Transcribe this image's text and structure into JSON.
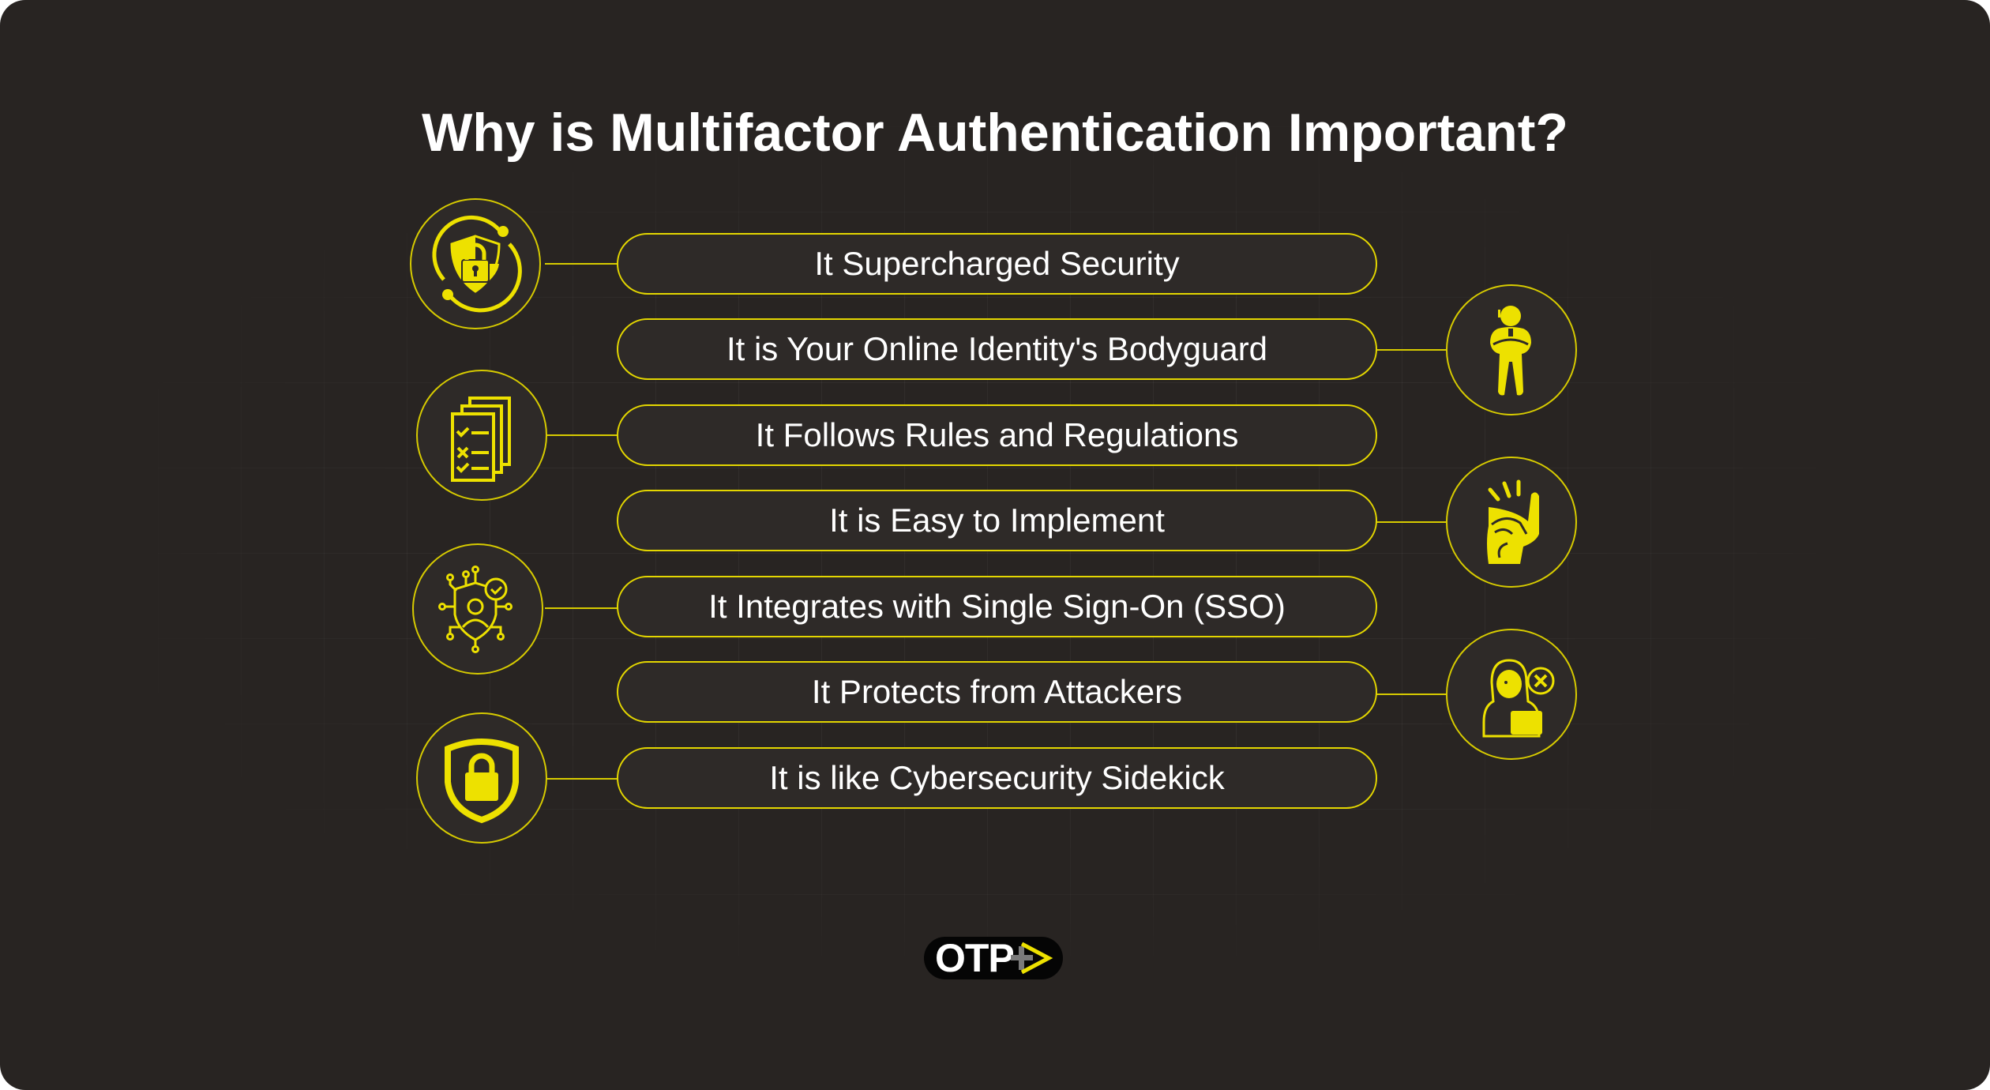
{
  "title": "Why is Multifactor Authentication Important?",
  "accent_color": "#ede100",
  "background_color": "#282422",
  "items": [
    {
      "label": "It Supercharged Security",
      "icon": "shield-lock-orbit-icon",
      "side": "left"
    },
    {
      "label": "It is Your Online Identity's Bodyguard",
      "icon": "bodyguard-icon",
      "side": "right"
    },
    {
      "label": "It Follows Rules and Regulations",
      "icon": "checklist-documents-icon",
      "side": "left"
    },
    {
      "label": "It is Easy to Implement",
      "icon": "finger-snap-icon",
      "side": "right"
    },
    {
      "label": "It Integrates with Single Sign-On (SSO)",
      "icon": "user-shield-network-icon",
      "side": "left"
    },
    {
      "label": "It Protects from Attackers",
      "icon": "hacker-blocked-icon",
      "side": "right"
    },
    {
      "label": "It is like Cybersecurity Sidekick",
      "icon": "shield-padlock-icon",
      "side": "left"
    }
  ],
  "logo": {
    "text": "OTP",
    "icon": "plus-arrow-icon"
  }
}
